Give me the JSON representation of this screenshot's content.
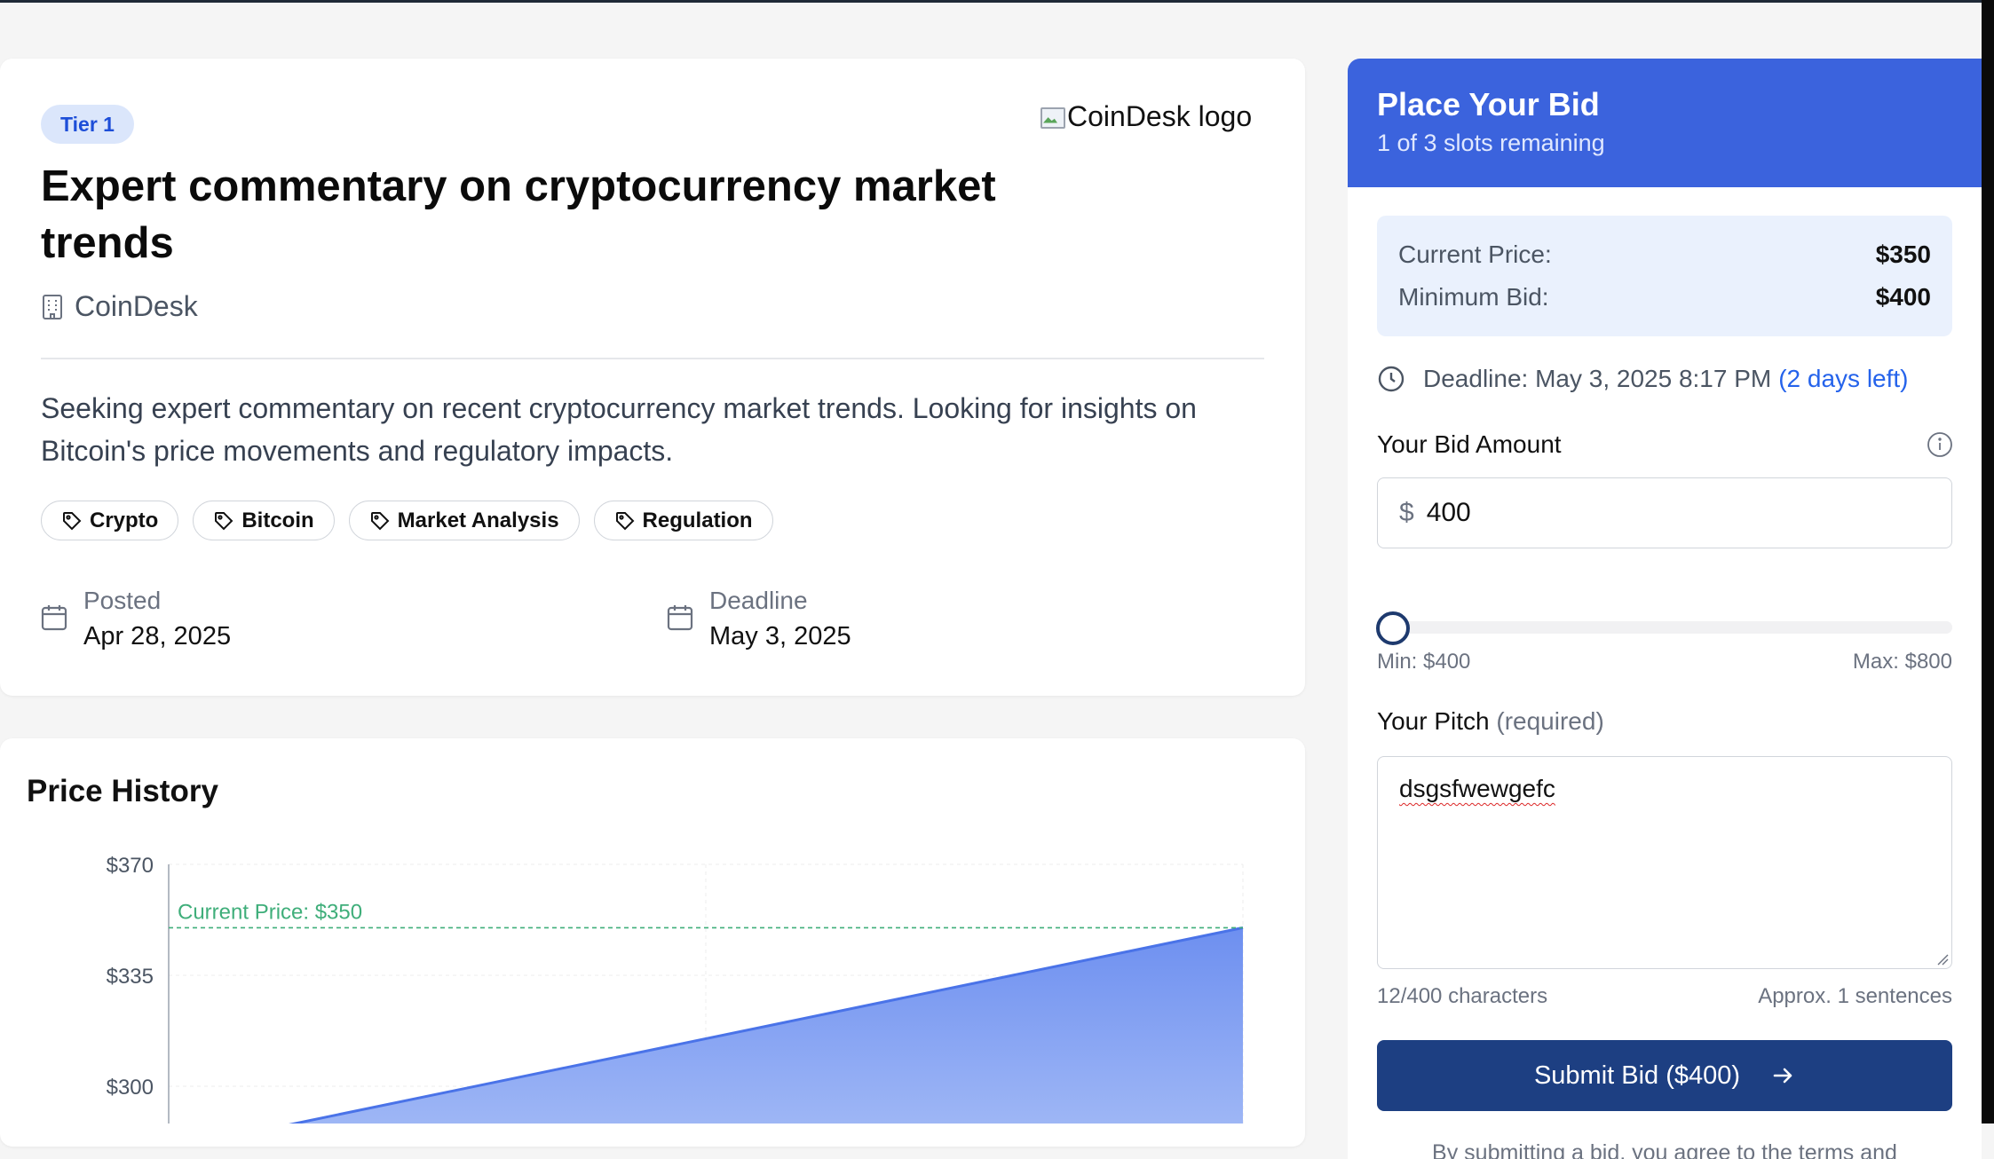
{
  "listing": {
    "tier": "Tier 1",
    "logo_alt": "CoinDesk logo",
    "title": "Expert commentary on cryptocurrency market trends",
    "company": "CoinDesk",
    "description": "Seeking expert commentary on recent cryptocurrency market trends. Looking for insights on Bitcoin's price movements and regulatory impacts.",
    "tags": [
      "Crypto",
      "Bitcoin",
      "Market Analysis",
      "Regulation"
    ],
    "posted_label": "Posted",
    "posted_date": "Apr 28, 2025",
    "deadline_label": "Deadline",
    "deadline_date": "May 3, 2025"
  },
  "history": {
    "title": "Price History"
  },
  "chart_data": {
    "type": "area",
    "title": "Price History",
    "y_ticks": [
      "$370",
      "$335",
      "$300"
    ],
    "ylim": [
      300,
      370
    ],
    "grid": true,
    "reference_line": {
      "label": "Current Price: $350",
      "value": 350
    },
    "series": [
      {
        "x": [
          0,
          1
        ],
        "values": [
          280,
          350
        ]
      }
    ]
  },
  "bid": {
    "title": "Place Your Bid",
    "slots": "1 of 3 slots remaining",
    "current_price_label": "Current Price:",
    "current_price": "$350",
    "min_bid_label": "Minimum Bid:",
    "min_bid": "$400",
    "deadline_text": "Deadline: May 3, 2025 8:17 PM",
    "days_left": "(2 days left)",
    "amount_label": "Your Bid Amount",
    "currency_symbol": "$",
    "amount_value": "400",
    "slider_min": "Min: $400",
    "slider_max": "Max: $800",
    "slider_level": 0,
    "pitch_label": "Your Pitch",
    "pitch_required": "(required)",
    "pitch_value": "dsgsfwewgefc",
    "char_count": "12/400 characters",
    "sentence_count": "Approx. 1 sentences",
    "submit_label": "Submit Bid ($400)",
    "terms": "By submitting a bid, you agree to the terms and conditions. You'll only be charged if your pitch is"
  },
  "colors": {
    "accent": "#3b63dd",
    "submit": "#1d3f82",
    "current_price_line": "#3fae7a",
    "area_fill": "#6d8ff0"
  }
}
